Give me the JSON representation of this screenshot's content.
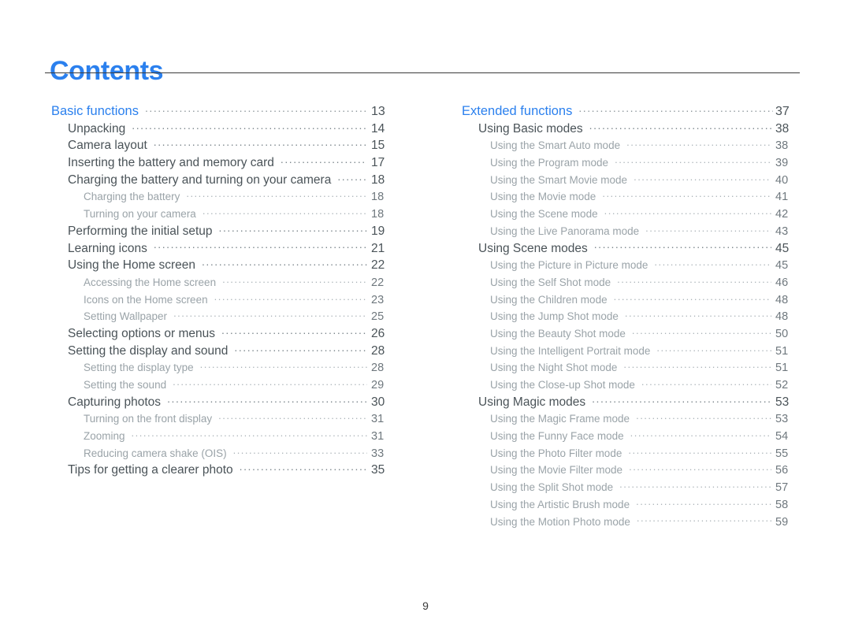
{
  "document": {
    "title": "Contents",
    "footer_page_number": "9",
    "accent_color": "#2b80ee",
    "level2_color": "#4a5358",
    "level3_color": "#9aa3a8"
  },
  "columns": {
    "left": {
      "entries": [
        {
          "level": 1,
          "label": "Basic functions",
          "page": "13"
        },
        {
          "level": 2,
          "label": "Unpacking",
          "page": "14"
        },
        {
          "level": 2,
          "label": "Camera layout",
          "page": "15"
        },
        {
          "level": 2,
          "label": "Inserting the battery and memory card",
          "page": "17"
        },
        {
          "level": 2,
          "label": "Charging the battery and turning on your camera",
          "page": "18"
        },
        {
          "level": 3,
          "label": "Charging the battery",
          "page": "18"
        },
        {
          "level": 3,
          "label": "Turning on your camera",
          "page": "18"
        },
        {
          "level": 2,
          "label": "Performing the initial setup",
          "page": "19"
        },
        {
          "level": 2,
          "label": "Learning icons",
          "page": "21"
        },
        {
          "level": 2,
          "label": "Using the Home screen",
          "page": "22"
        },
        {
          "level": 3,
          "label": "Accessing the Home screen",
          "page": "22"
        },
        {
          "level": 3,
          "label": "Icons on the Home screen",
          "page": "23"
        },
        {
          "level": 3,
          "label": "Setting Wallpaper",
          "page": "25"
        },
        {
          "level": 2,
          "label": "Selecting options or menus",
          "page": "26"
        },
        {
          "level": 2,
          "label": "Setting the display and sound",
          "page": "28"
        },
        {
          "level": 3,
          "label": "Setting the display type",
          "page": "28"
        },
        {
          "level": 3,
          "label": "Setting the sound",
          "page": "29"
        },
        {
          "level": 2,
          "label": "Capturing photos",
          "page": "30"
        },
        {
          "level": 3,
          "label": "Turning on the front display",
          "page": "31"
        },
        {
          "level": 3,
          "label": "Zooming",
          "page": "31"
        },
        {
          "level": 3,
          "label": "Reducing camera shake (OIS)",
          "page": "33"
        },
        {
          "level": 2,
          "label": "Tips for getting a clearer photo",
          "page": "35"
        }
      ]
    },
    "right": {
      "entries": [
        {
          "level": 1,
          "label": "Extended functions",
          "page": "37"
        },
        {
          "level": 2,
          "label": "Using Basic modes",
          "page": "38"
        },
        {
          "level": 3,
          "label": "Using the Smart Auto mode",
          "page": "38"
        },
        {
          "level": 3,
          "label": "Using the Program mode",
          "page": "39"
        },
        {
          "level": 3,
          "label": "Using the Smart Movie mode",
          "page": "40"
        },
        {
          "level": 3,
          "label": "Using the Movie mode",
          "page": "41"
        },
        {
          "level": 3,
          "label": "Using the Scene mode",
          "page": "42"
        },
        {
          "level": 3,
          "label": "Using the Live Panorama mode",
          "page": "43"
        },
        {
          "level": 2,
          "label": "Using Scene modes",
          "page": "45"
        },
        {
          "level": 3,
          "label": "Using the Picture in Picture mode",
          "page": "45"
        },
        {
          "level": 3,
          "label": "Using the Self Shot mode",
          "page": "46"
        },
        {
          "level": 3,
          "label": "Using the Children mode",
          "page": "48"
        },
        {
          "level": 3,
          "label": "Using the Jump Shot mode",
          "page": "48"
        },
        {
          "level": 3,
          "label": "Using the Beauty Shot mode",
          "page": "50"
        },
        {
          "level": 3,
          "label": "Using the Intelligent Portrait mode",
          "page": "51"
        },
        {
          "level": 3,
          "label": "Using the Night Shot mode",
          "page": "51"
        },
        {
          "level": 3,
          "label": "Using the Close-up Shot mode",
          "page": "52"
        },
        {
          "level": 2,
          "label": "Using Magic modes",
          "page": "53"
        },
        {
          "level": 3,
          "label": "Using the Magic Frame mode",
          "page": "53"
        },
        {
          "level": 3,
          "label": "Using the Funny Face mode",
          "page": "54"
        },
        {
          "level": 3,
          "label": "Using the Photo Filter mode",
          "page": "55"
        },
        {
          "level": 3,
          "label": "Using the Movie Filter mode",
          "page": "56"
        },
        {
          "level": 3,
          "label": "Using the Split Shot mode",
          "page": "57"
        },
        {
          "level": 3,
          "label": "Using the Artistic Brush mode",
          "page": "58"
        },
        {
          "level": 3,
          "label": "Using the Motion Photo mode",
          "page": "59"
        }
      ]
    }
  }
}
